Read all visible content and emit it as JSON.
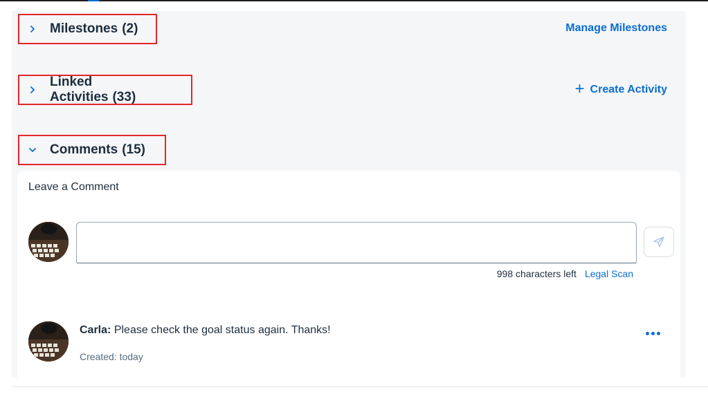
{
  "sections": {
    "milestones": {
      "title": "Milestones",
      "count": "(2)",
      "action_label": "Manage Milestones"
    },
    "linked_activities": {
      "title": "Linked Activities",
      "count": "(33)",
      "action_label": "Create Activity"
    },
    "comments": {
      "title": "Comments",
      "count": "(15)"
    }
  },
  "comment_form": {
    "heading": "Leave a Comment",
    "input_value": "",
    "chars_left": "998 characters left",
    "legal_scan_label": "Legal Scan"
  },
  "comments_list": [
    {
      "author": "Carla:",
      "text": "Please check the goal status again. Thanks!",
      "created": "Created: today"
    }
  ],
  "icons": {
    "collapsed": "chevron-right-icon",
    "expanded": "chevron-down-icon",
    "add": "plus-icon",
    "send": "send-icon",
    "more": "more-horizontal-icon"
  },
  "colors": {
    "accent": "#0a6ed1",
    "highlight_border": "#e3262a",
    "text": "#1d2d3e"
  }
}
